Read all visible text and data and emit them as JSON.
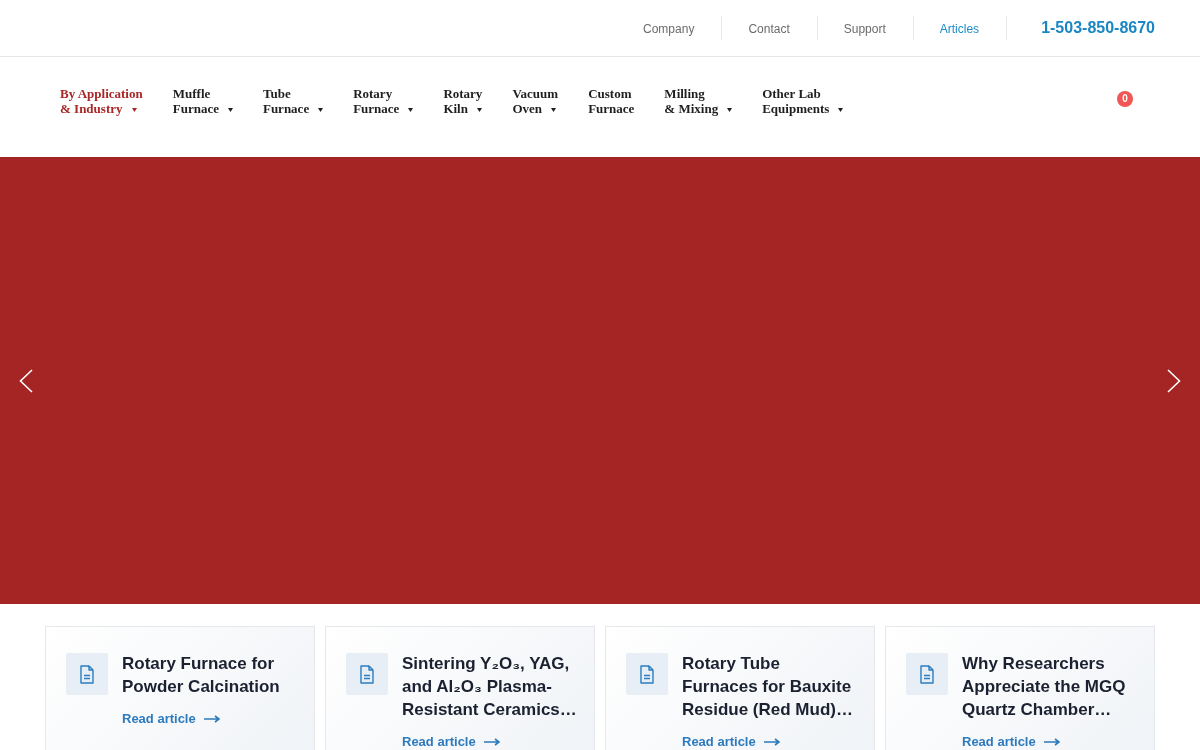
{
  "top_bar": {
    "links": [
      {
        "label": "Company",
        "selected": false
      },
      {
        "label": "Contact",
        "selected": false
      },
      {
        "label": "Support",
        "selected": false
      },
      {
        "label": "Articles",
        "selected": true
      }
    ],
    "phone": "1-503-850-8670"
  },
  "main_nav": {
    "items": [
      {
        "label_lines": [
          "By Application",
          "& Industry"
        ],
        "selected": true,
        "has_dropdown": true
      },
      {
        "label_lines": [
          "Muffle",
          "Furnace"
        ],
        "selected": false,
        "has_dropdown": true
      },
      {
        "label_lines": [
          "Tube",
          "Furnace"
        ],
        "selected": false,
        "has_dropdown": true
      },
      {
        "label_lines": [
          "Rotary",
          "Furnace"
        ],
        "selected": false,
        "has_dropdown": true
      },
      {
        "label_lines": [
          "Rotary",
          "Kiln"
        ],
        "selected": false,
        "has_dropdown": true
      },
      {
        "label_lines": [
          "Vacuum",
          "Oven"
        ],
        "selected": false,
        "has_dropdown": true
      },
      {
        "label_lines": [
          "Custom",
          "Furnace"
        ],
        "selected": false,
        "has_dropdown": false
      },
      {
        "label_lines": [
          "Milling",
          "& Mixing"
        ],
        "selected": false,
        "has_dropdown": true
      },
      {
        "label_lines": [
          "Other Lab",
          "Equipments"
        ],
        "selected": false,
        "has_dropdown": true
      }
    ],
    "cart_count": "0"
  },
  "articles": [
    {
      "title_lines": [
        "Rotary Furnace for",
        "Powder Calcination"
      ],
      "link": "Read article"
    },
    {
      "title_lines": [
        "Sintering Y₂O₃, YAG,",
        "and Al₂O₃ Plasma-",
        "Resistant Ceramics…"
      ],
      "link": "Read article"
    },
    {
      "title_lines": [
        "Rotary Tube",
        "Furnaces for Bauxite",
        "Residue (Red Mud)…"
      ],
      "link": "Read article"
    },
    {
      "title_lines": [
        "Why Researchers",
        "Appreciate the MGQ",
        "Quartz Chamber…"
      ],
      "link": "Read article"
    }
  ]
}
